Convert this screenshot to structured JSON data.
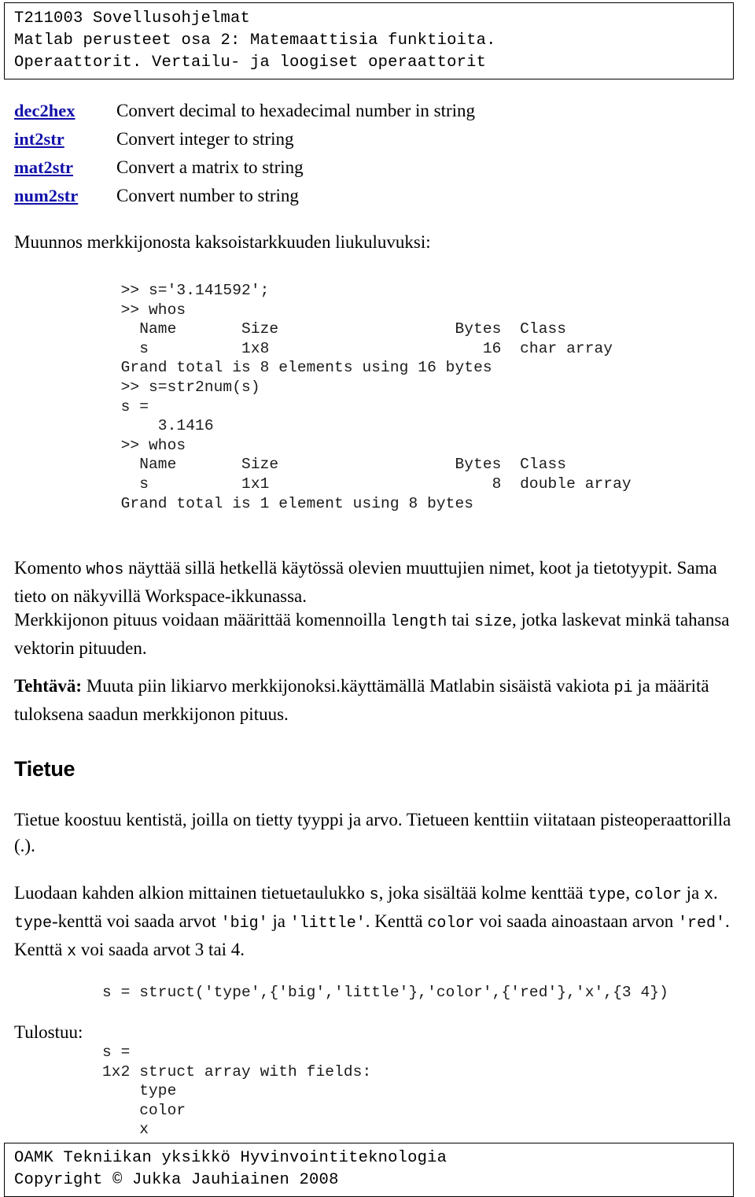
{
  "header": {
    "lines": [
      "T211003 Sovellusohjelmat",
      "Matlab perusteet osa 2: Matemaattisia funktioita.",
      "Operaattorit. Vertailu- ja loogiset operaattorit"
    ]
  },
  "functions": [
    {
      "name": "dec2hex",
      "desc": "Convert decimal to hexadecimal number in string"
    },
    {
      "name": "int2str",
      "desc": "Convert integer to string"
    },
    {
      "name": "mat2str",
      "desc": "Convert a matrix to string"
    },
    {
      "name": "num2str",
      "desc": "Convert number to string"
    }
  ],
  "intro": {
    "muunnos": "Muunnos merkkijonosta kaksoistarkkuuden liukuluvuksi:"
  },
  "code_whos": "  >> s='3.141592';\n  >> whos\n    Name       Size                   Bytes  Class\n    s          1x8                       16  char array\n  Grand total is 8 elements using 16 bytes\n  >> s=str2num(s)\n  s =\n      3.1416\n  >> whos\n    Name       Size                   Bytes  Class\n    s          1x1                        8  double array\n  Grand total is 1 element using 8 bytes",
  "para_whos": {
    "p1a": "Komento ",
    "p1_mono1": "whos",
    "p1b": " näyttää sillä hetkellä käytössä olevien muuttujien nimet, koot ja tietotyypit. Sama tieto on näkyvillä Workspace-ikkunassa.",
    "p2a": "Merkkijonon pituus voidaan määrittää komennoilla ",
    "p2_mono1": "length",
    "p2b": " tai ",
    "p2_mono2": "size",
    "p2c": ", jotka laskevat minkä tahansa vektorin pituuden."
  },
  "para_tehtava": {
    "bold": "Tehtävä:",
    "a": " Muuta piin likiarvo  merkkijonoksi.käyttämällä Matlabin sisäistä vakiota ",
    "mono1": "pi",
    "b": " ja määritä tuloksena saadun merkkijonon pituus."
  },
  "tietue": {
    "heading": "Tietue",
    "p1": "Tietue koostuu kentistä, joilla on tietty tyyppi ja arvo. Tietueen kenttiin viitataan pisteoperaattorilla (.).",
    "p2a": "Luodaan kahden alkion mittainen tietuetaulukko ",
    "p2_mono_s": "s",
    "p2b": ", joka sisältää kolme kenttää ",
    "p2_mono_type": "type",
    "p2c": ", ",
    "p2_mono_color": "color",
    "p2d": " ja ",
    "p2_mono_x": "x",
    "p2e": ". ",
    "p2_mono_type2": "type",
    "p2f": "-kenttä voi saada arvot ",
    "p2_mono_big": "'big'",
    "p2g": " ja ",
    "p2_mono_little": "'little'",
    "p2h": ". Kenttä ",
    "p2_mono_color2": "color",
    "p2i": " voi saada ainoastaan arvon ",
    "p2_mono_red": "'red'",
    "p2j": ". Kenttä ",
    "p2_mono_x2": "x",
    "p2k": " voi saada arvot 3 tai 4."
  },
  "code_struct": "s = struct('type',{'big','little'},'color',{'red'},'x',{3 4})",
  "tulostuu_label": "Tulostuu:",
  "code_output": "s =\n1x2 struct array with fields:\n    type\n    color\n    x",
  "footer": {
    "lines": [
      "OAMK Tekniikan yksikkö Hyvinvointiteknologia",
      "Copyright © Jukka Jauhiainen 2008"
    ]
  }
}
